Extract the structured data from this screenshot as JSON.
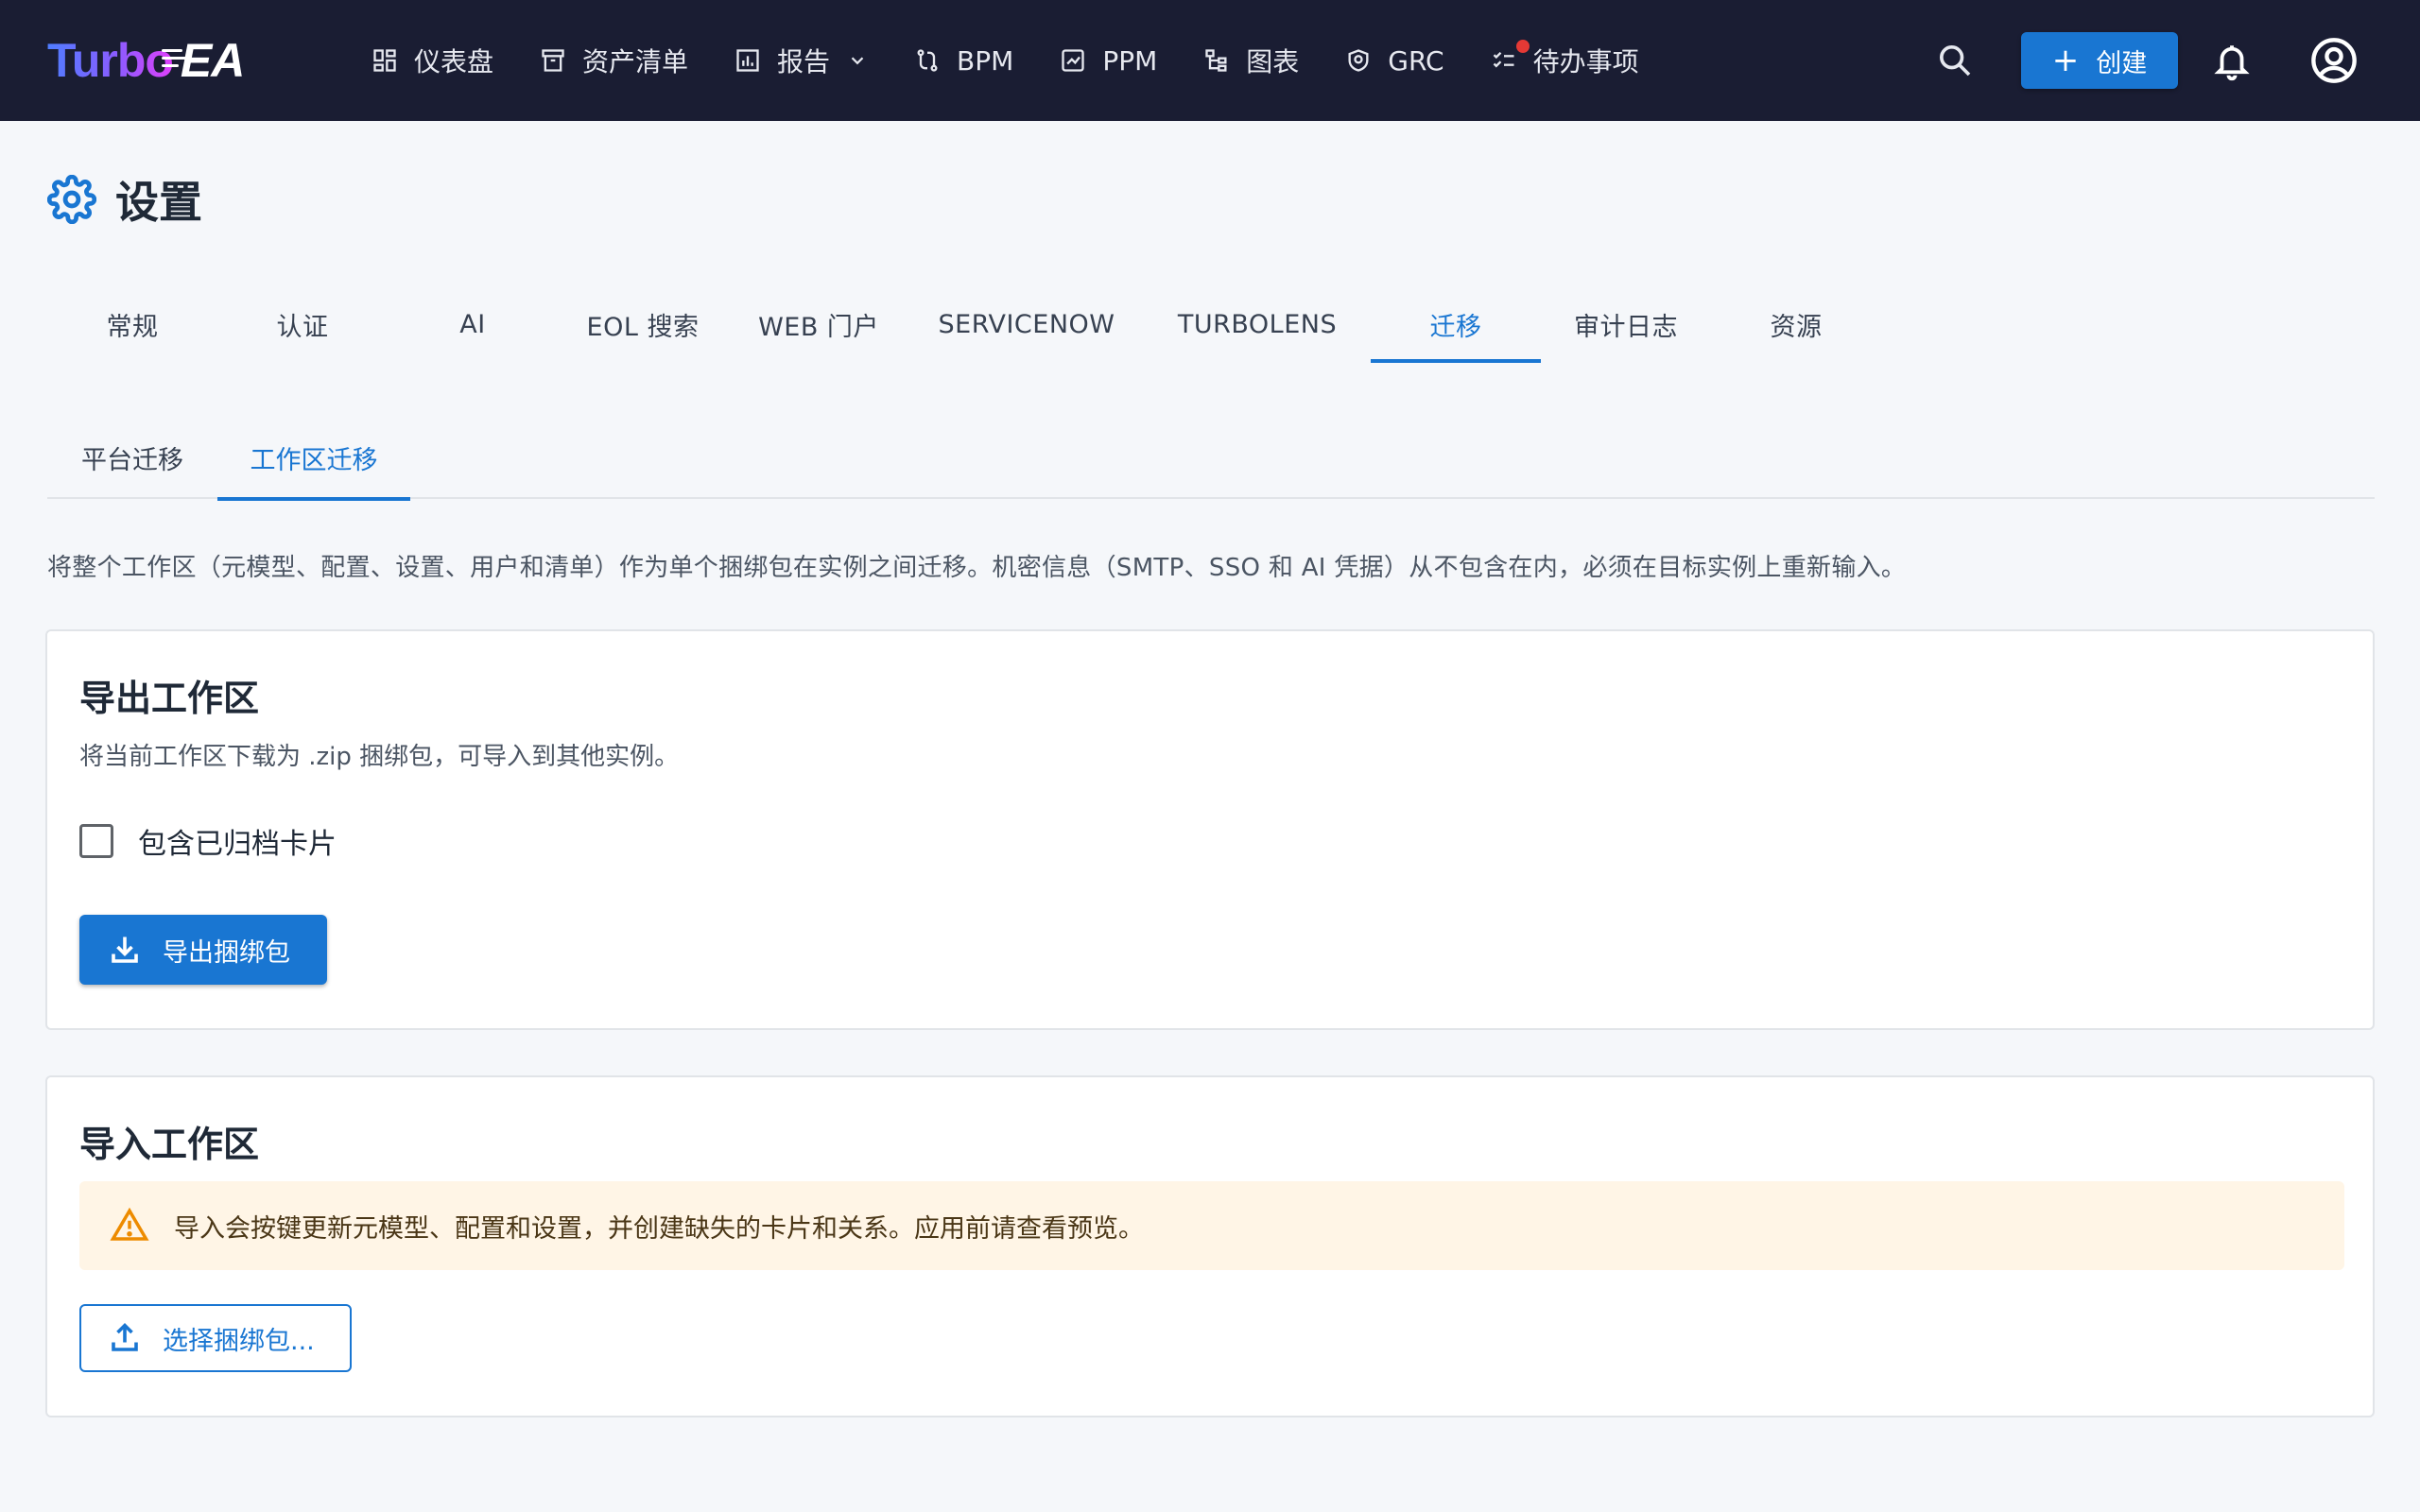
{
  "app": {
    "logo_part1": "Turbo",
    "logo_part2": "EA"
  },
  "nav": {
    "items": [
      {
        "label": "仪表盘",
        "icon": "dashboard-icon"
      },
      {
        "label": "资产清单",
        "icon": "inventory-icon"
      },
      {
        "label": "报告",
        "icon": "report-icon",
        "has_dropdown": true
      },
      {
        "label": "BPM",
        "icon": "bpm-icon"
      },
      {
        "label": "PPM",
        "icon": "ppm-icon"
      },
      {
        "label": "图表",
        "icon": "diagram-icon"
      },
      {
        "label": "GRC",
        "icon": "grc-icon"
      },
      {
        "label": "待办事项",
        "icon": "todo-icon",
        "has_notification_dot": true
      }
    ],
    "create_label": "创建"
  },
  "page": {
    "title": "设置"
  },
  "tabs": {
    "items": [
      "常规",
      "认证",
      "AI",
      "EOL 搜索",
      "WEB 门户",
      "SERVICENOW",
      "TURBOLENS",
      "迁移",
      "审计日志",
      "资源"
    ],
    "active_index": 7
  },
  "subtabs": {
    "items": [
      "平台迁移",
      "工作区迁移"
    ],
    "active_index": 1
  },
  "intro": "将整个工作区（元模型、配置、设置、用户和清单）作为单个捆绑包在实例之间迁移。机密信息（SMTP、SSO 和 AI 凭据）从不包含在内，必须在目标实例上重新输入。",
  "export": {
    "title": "导出工作区",
    "description": "将当前工作区下载为 .zip 捆绑包，可导入到其他实例。",
    "checkbox_label": "包含已归档卡片",
    "checkbox_checked": false,
    "button_label": "导出捆绑包"
  },
  "import": {
    "title": "导入工作区",
    "warning": "导入会按键更新元模型、配置和设置，并创建缺失的卡片和关系。应用前请查看预览。",
    "button_label": "选择捆绑包..."
  },
  "colors": {
    "topbar": "#1a1d33",
    "accent": "#1976d2",
    "warning_bg": "#fff5e6",
    "warning_icon": "#ed8b00",
    "notification": "#e53935"
  }
}
